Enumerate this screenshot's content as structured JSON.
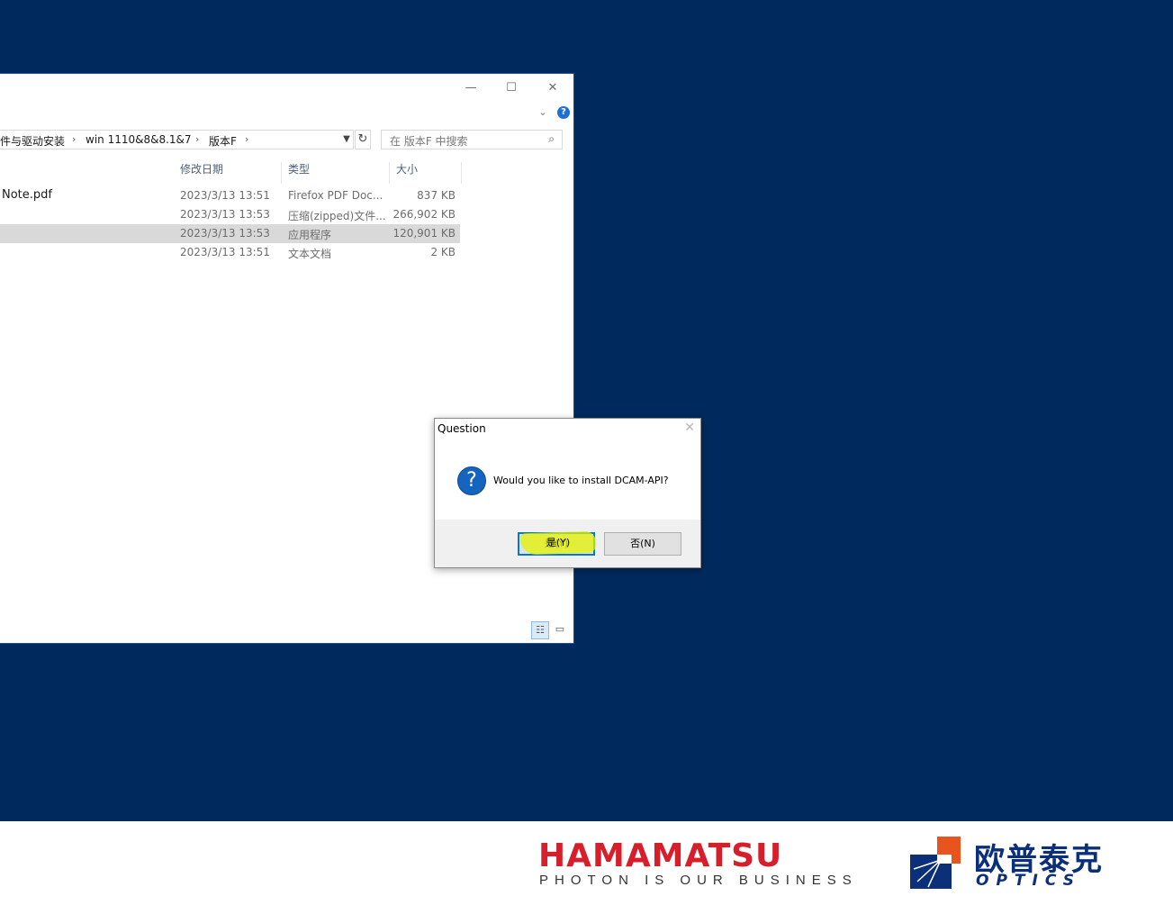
{
  "explorer": {
    "window_controls": {
      "minimize": "—",
      "maximize": "☐",
      "close": "✕"
    },
    "breadcrumb": [
      "件与驱动安装",
      "win 1110&8&8.1&7",
      "版本F"
    ],
    "search_placeholder": "在 版本F 中搜索",
    "columns": {
      "date": "修改日期",
      "type": "类型",
      "size": "大小"
    },
    "files": [
      {
        "name": "Note.pdf",
        "date": "2023/3/13 13:51",
        "type": "Firefox PDF Doc...",
        "size": "837 KB",
        "selected": false
      },
      {
        "name": "",
        "date": "2023/3/13 13:53",
        "type": "压缩(zipped)文件...",
        "size": "266,902 KB",
        "selected": false
      },
      {
        "name": "",
        "date": "2023/3/13 13:53",
        "type": "应用程序",
        "size": "120,901 KB",
        "selected": true
      },
      {
        "name": "",
        "date": "2023/3/13 13:51",
        "type": "文本文档",
        "size": "2 KB",
        "selected": false
      }
    ]
  },
  "dialog": {
    "title": "Question",
    "message": "Would you like to install DCAM-API?",
    "yes_label": "是(Y)",
    "no_label": "否(N)"
  },
  "branding": {
    "hamamatsu": "HAMAMATSU",
    "hamamatsu_tagline": "PHOTON IS OUR BUSINESS",
    "optics_cn": "欧普泰克",
    "optics_en": "OPTICS",
    "hamamatsu_color": "#d71f2b",
    "optics_color": "#0c2f7a",
    "desktop_color": "#002a5e"
  }
}
